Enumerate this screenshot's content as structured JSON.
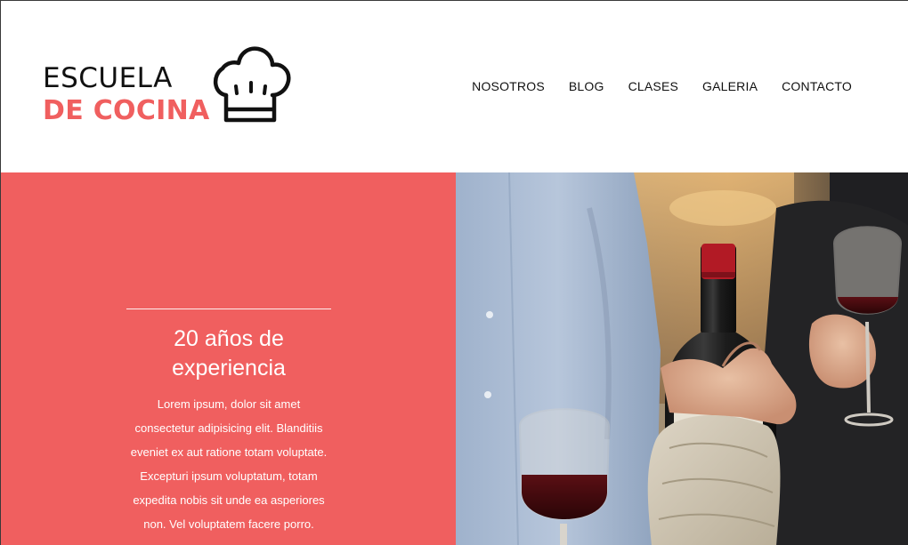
{
  "logo": {
    "line1": "ESCUELA",
    "line2": "DE COCINA",
    "icon": "chef-hat-icon"
  },
  "nav": {
    "items": [
      {
        "label": "NOSOTROS"
      },
      {
        "label": "BLOG"
      },
      {
        "label": "CLASES"
      },
      {
        "label": "GALERIA"
      },
      {
        "label": "CONTACTO"
      }
    ]
  },
  "hero": {
    "title": "20 años de experiencia",
    "text": "Lorem ipsum, dolor sit amet consectetur adipisicing elit. Blanditiis eveniet ex aut ratione totam voluptate. Excepturi ipsum voluptatum, totam expedita nobis sit unde ea asperiores non. Vel voluptatem facere porro.",
    "image": "wine-bottle-photo"
  },
  "colors": {
    "accent": "#f05f5f",
    "text_dark": "#111111",
    "white": "#ffffff"
  }
}
